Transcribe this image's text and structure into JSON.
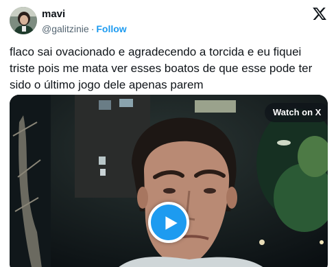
{
  "author": {
    "name": "mavi",
    "handle": "@galitzinie",
    "separator": "·",
    "follow_label": "Follow",
    "avatar_icon": "user-avatar"
  },
  "brand": {
    "logo_icon": "x-logo-icon"
  },
  "tweet": {
    "text": "flaco sai ovacionado e agradecendo a torcida e eu fiquei triste pois me mata ver esses boatos de que esse pode ter sido o último jogo dele apenas parem"
  },
  "media": {
    "watch_label": "Watch on X",
    "play_icon": "play-icon",
    "accent_color": "#1d9bf0"
  }
}
